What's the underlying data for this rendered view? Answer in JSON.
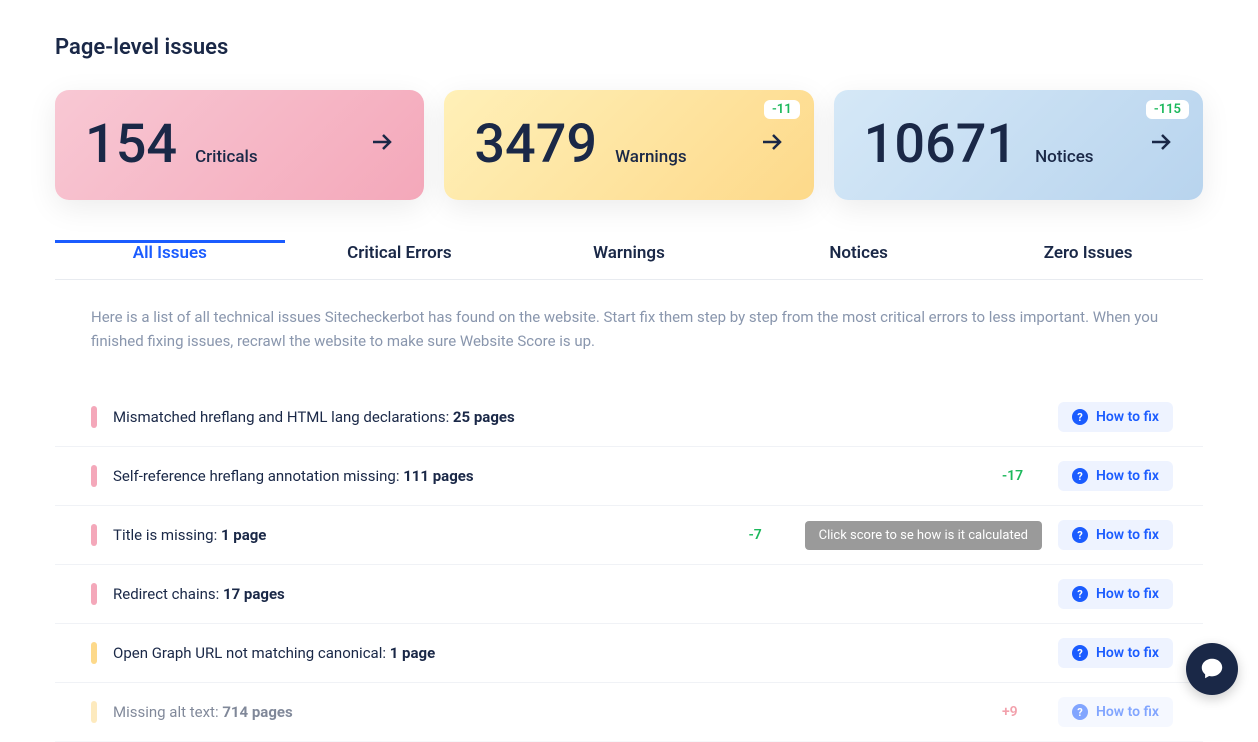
{
  "title": "Page-level issues",
  "stats": {
    "criticals": {
      "value": "154",
      "label": "Criticals",
      "delta": null
    },
    "warnings": {
      "value": "3479",
      "label": "Warnings",
      "delta": "-11"
    },
    "notices": {
      "value": "10671",
      "label": "Notices",
      "delta": "-115"
    }
  },
  "tabs": {
    "all": "All Issues",
    "critical": "Critical Errors",
    "warnings": "Warnings",
    "notices": "Notices",
    "zero": "Zero Issues"
  },
  "description": "Here is a list of all technical issues Sitecheckerbot has found on the website. Start fix them step by step from the most critical errors to less important. When you finished fixing issues, recrawl the website to make sure Website Score is up.",
  "howtofix_label": "How to fix",
  "tooltip": "Click score to se how is it calculated",
  "issues": [
    {
      "severity": "critical",
      "text": "Mismatched hreflang and HTML lang declarations: ",
      "count": "25 pages",
      "delta": "",
      "delta_class": ""
    },
    {
      "severity": "critical",
      "text": "Self-reference hreflang annotation missing: ",
      "count": "111 pages",
      "delta": "-17",
      "delta_class": "green"
    },
    {
      "severity": "critical",
      "text": "Title is missing: ",
      "count": "1 page",
      "delta": "-7",
      "delta_class": "green",
      "tooltip": true
    },
    {
      "severity": "critical",
      "text": "Redirect chains: ",
      "count": "17 pages",
      "delta": "",
      "delta_class": ""
    },
    {
      "severity": "warning",
      "text": "Open Graph URL not matching canonical: ",
      "count": "1 page",
      "delta": "",
      "delta_class": ""
    },
    {
      "severity": "warning",
      "text": "Missing alt text: ",
      "count": "714 pages",
      "delta": "+9",
      "delta_class": "red"
    }
  ]
}
